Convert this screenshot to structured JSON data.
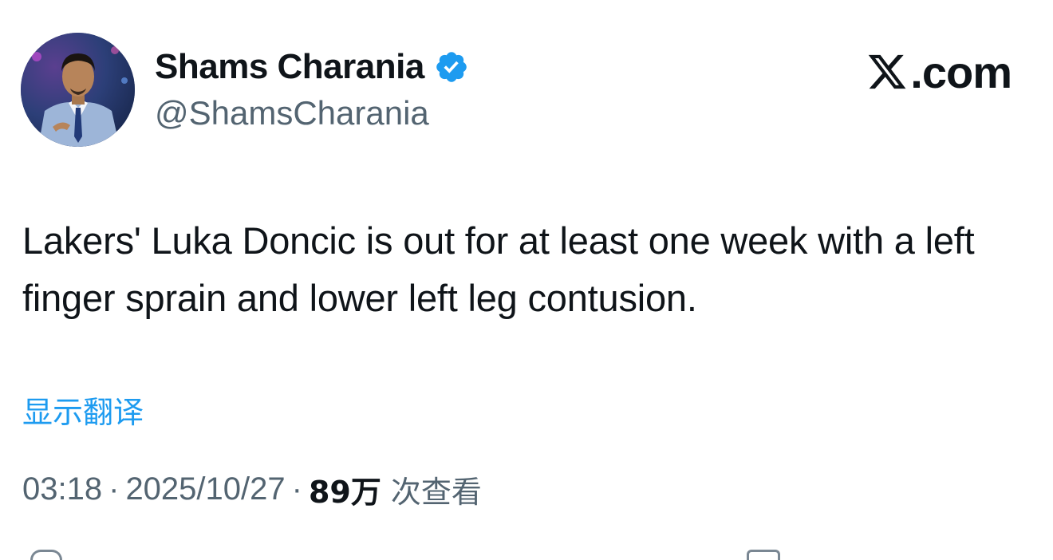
{
  "author": {
    "display_name": "Shams Charania",
    "handle": "@ShamsCharania",
    "verified": true,
    "verified_color": "#1d9bf0"
  },
  "brand": {
    "logo_icon": "x-logo-icon",
    "text": ".com"
  },
  "tweet": {
    "text": "Lakers' Luka Doncic is out for at least one week with a left finger sprain and lower left leg contusion."
  },
  "translate": {
    "label": "显示翻译",
    "color": "#1d9bf0"
  },
  "meta": {
    "time": "03:18",
    "separator": "·",
    "date": "2025/10/27",
    "views_count": "89万",
    "views_label": "次查看"
  },
  "colors": {
    "text_primary": "#0f1419",
    "text_secondary": "#536471",
    "link": "#1d9bf0",
    "background": "#ffffff"
  }
}
